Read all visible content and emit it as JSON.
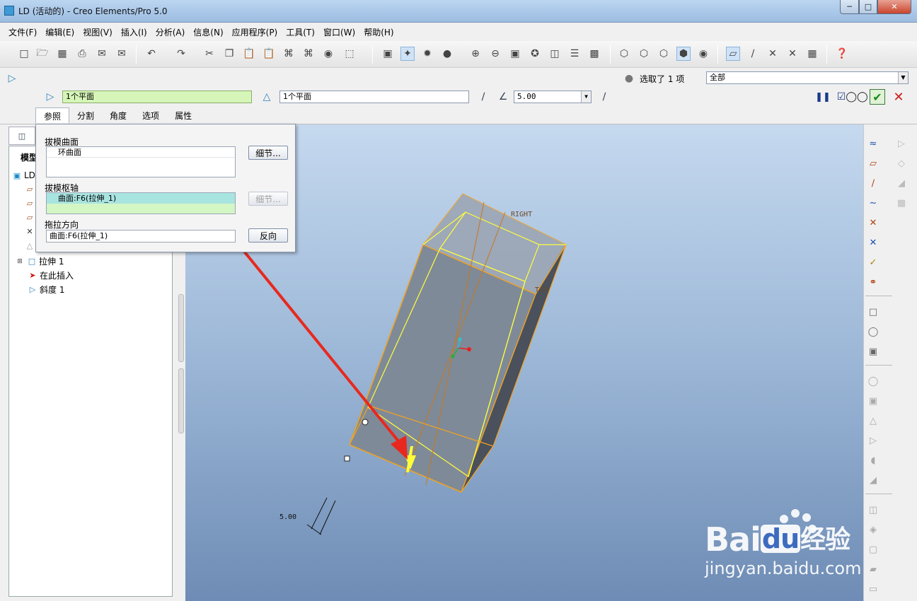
{
  "window": {
    "title": "LD (活动的) - Creo Elements/Pro 5.0",
    "minimize": "─",
    "maximize": "□",
    "close": "✕"
  },
  "menu": [
    "文件(F)",
    "编辑(E)",
    "视图(V)",
    "插入(I)",
    "分析(A)",
    "信息(N)",
    "应用程序(P)",
    "工具(T)",
    "窗口(W)",
    "帮助(H)"
  ],
  "dashboard": {
    "draft_surface_field": "1个平面",
    "draft_hinge_field": "1个平面",
    "angle_value": "5.00",
    "selection_status": "选取了 1 项",
    "filter_value": "全部",
    "tabs": [
      "参照",
      "分割",
      "角度",
      "选项",
      "属性"
    ],
    "active_tab": "参照"
  },
  "ref_panel": {
    "draft_surfaces_label": "拔模曲面",
    "draft_surfaces_items": [
      "环曲面"
    ],
    "details_button": "细节...",
    "draft_hinges_label": "拔模枢轴",
    "draft_hinges_items": [
      "曲面:F6(拉伸_1)"
    ],
    "details_button_2": "细节...",
    "pull_direction_label": "拖拉方向",
    "pull_direction_value": "曲面:F6(拉伸_1)",
    "flip_button": "反向"
  },
  "model_tree": {
    "header": "模型",
    "items": [
      {
        "label": "LD",
        "icon": "part-icon"
      },
      {
        "label": "",
        "icon": "datum-plane-icon"
      },
      {
        "label": "",
        "icon": "datum-plane-icon"
      },
      {
        "label": "",
        "icon": "datum-plane-icon"
      },
      {
        "label": "",
        "icon": "csys-icon"
      },
      {
        "label": "",
        "icon": "feature-icon"
      },
      {
        "label": "拉伸 1",
        "icon": "extrude-icon"
      },
      {
        "label": "在此插入",
        "icon": "insert-arrow-icon"
      },
      {
        "label": "斜度 1",
        "icon": "draft-icon"
      }
    ]
  },
  "viewport": {
    "datum_labels": [
      "RIGHT",
      "TOP"
    ],
    "angle_dimension": "5.00",
    "colors": {
      "wire": "#f2a31e",
      "wire_yellow": "#ffff3a",
      "arrow": "#e8281e",
      "body": "#7f8a98"
    }
  },
  "watermark": {
    "brand": "Bai",
    "brand2": "du",
    "cn": "经验",
    "url": "jingyan.baidu.com"
  }
}
